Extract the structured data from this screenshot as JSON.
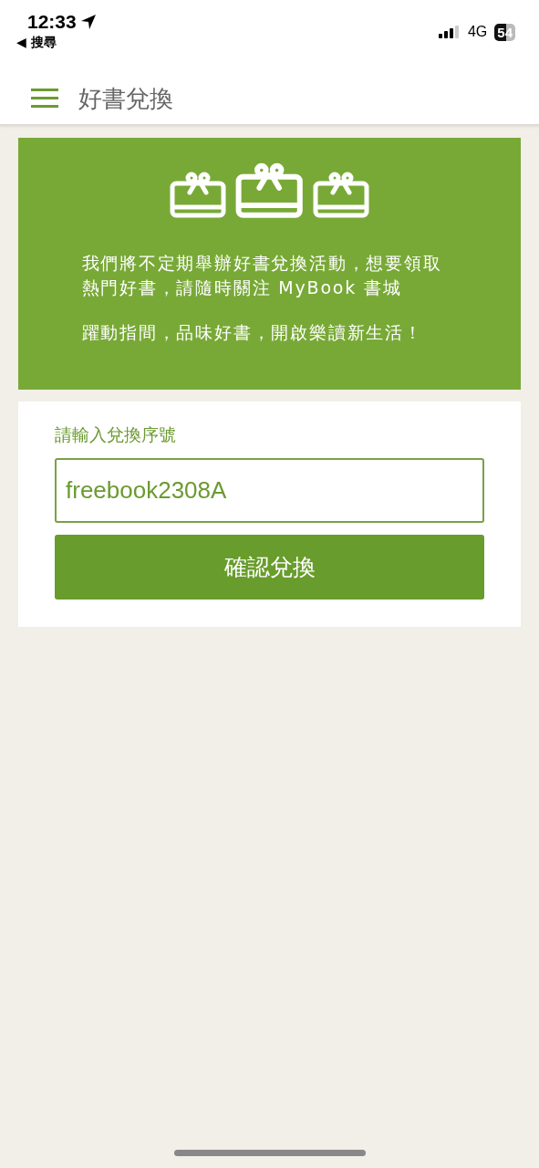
{
  "status_bar": {
    "time": "12:33",
    "back_label": "◀ 搜尋",
    "network": "4G",
    "battery": "54"
  },
  "header": {
    "title": "好書兌換"
  },
  "banner": {
    "paragraphs": [
      "我們將不定期舉辦好書兌換活動，想要領取熱門好書，請隨時關注 MyBook 書城",
      "躍動指間，品味好書，開啟樂讀新生活！"
    ]
  },
  "redeem_form": {
    "label": "請輸入兌換序號",
    "value": "freebook2308A",
    "button": "確認兌換"
  }
}
